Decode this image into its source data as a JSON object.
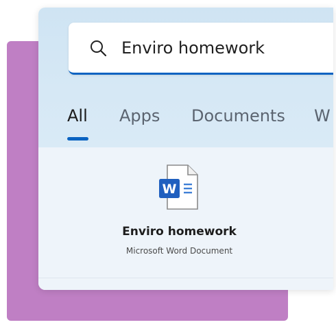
{
  "search": {
    "query": "Enviro homework",
    "icon": "search-icon"
  },
  "tabs": [
    {
      "label": "All",
      "active": true
    },
    {
      "label": "Apps",
      "active": false
    },
    {
      "label": "Documents",
      "active": false
    },
    {
      "label": "W",
      "active": false
    }
  ],
  "results": [
    {
      "icon": "word-document-icon",
      "name": "Enviro homework",
      "type": "Microsoft Word Document"
    }
  ],
  "colors": {
    "accent": "#0a63c1",
    "backdrop_card": "#bf7fc4",
    "panel_top": "#d3e6f4",
    "panel_body": "#eef4fa",
    "word_blue": "#1f5fbf"
  }
}
